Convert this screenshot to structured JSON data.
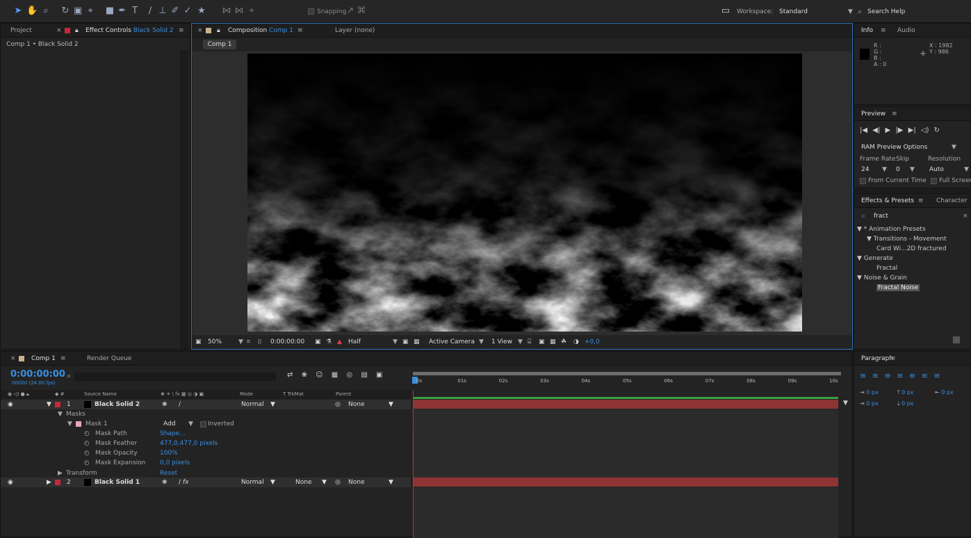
{
  "toolbar": {
    "snapping": "Snapping",
    "workspace_label": "Workspace:",
    "workspace_value": "Standard",
    "search_help": "Search Help"
  },
  "project_tabs": {
    "project": "Project",
    "effect_controls": "Effect Controls",
    "effect_controls_layer": "Black Solid 2",
    "breadcrumb": "Comp 1 • Black Solid 2"
  },
  "comp_tabs": {
    "composition": "Composition",
    "composition_name": "Comp 1",
    "layer": "Layer (none)",
    "comp_button": "Comp 1"
  },
  "viewer_bar": {
    "zoom": "50%",
    "timecode": "0:00:00:00",
    "resolution": "Half",
    "camera": "Active Camera",
    "views": "1 View",
    "exposure": "+0,0"
  },
  "info": {
    "tab": "Info",
    "audio": "Audio",
    "r": "R :",
    "g": "G :",
    "b": "B :",
    "a": "A : 0",
    "x": "X : 1982",
    "y": "Y : 986"
  },
  "preview": {
    "tab": "Preview",
    "ram_options": "RAM Preview Options",
    "frame_rate_label": "Frame Rate",
    "skip_label": "Skip",
    "resolution_label": "Resolution",
    "frame_rate": "24",
    "skip": "0",
    "resolution": "Auto",
    "from_current": "From Current Time",
    "full_screen": "Full Screen"
  },
  "effects": {
    "tab": "Effects & Presets",
    "character": "Character",
    "search": "fract",
    "tree": [
      {
        "text": "▼ * Animation Presets",
        "indent": 0
      },
      {
        "text": "▼ Transitions - Movement",
        "indent": 1,
        "folder": true
      },
      {
        "text": "Card Wi...2D fractured",
        "indent": 2
      },
      {
        "text": "▼ Generate",
        "indent": 0
      },
      {
        "text": "Fractal",
        "indent": 2
      },
      {
        "text": "▼ Noise & Grain",
        "indent": 0
      },
      {
        "text": "Fractal Noise",
        "indent": 2,
        "selected": true
      }
    ]
  },
  "timeline": {
    "tab": "Comp 1",
    "render_queue": "Render Queue",
    "timecode": "0:00:00:00",
    "fps": "00000 (24.00 fps)",
    "headers": {
      "source_name": "Source Name",
      "mode": "Mode",
      "trkmat": "T  TrkMat",
      "parent": "Parent"
    },
    "ruler": [
      "0s",
      "01s",
      "02s",
      "03s",
      "04s",
      "05s",
      "06s",
      "07s",
      "08s",
      "09s",
      "10s"
    ],
    "layer1": {
      "num": "1",
      "name": "Black Solid 2",
      "mode": "Normal",
      "parent": "None"
    },
    "masks": "Masks",
    "mask1": "Mask 1",
    "mask_mode": "Add",
    "inverted": "Inverted",
    "props": [
      {
        "name": "Mask Path",
        "value": "Shape..."
      },
      {
        "name": "Mask Feather",
        "value": "477,0,477,0 pixels"
      },
      {
        "name": "Mask Opacity",
        "value": "100%"
      },
      {
        "name": "Mask Expansion",
        "value": "0,0 pixels"
      }
    ],
    "transform": "Transform",
    "reset": "Reset",
    "layer2": {
      "num": "2",
      "name": "Black Solid 1",
      "mode": "Normal",
      "trkmat": "None",
      "parent": "None"
    }
  },
  "paragraph": {
    "tab": "Paragraph",
    "v1": "0 px",
    "v2": "0 px",
    "v3": "0 px",
    "v4": "0 px",
    "v5": "0 px"
  }
}
